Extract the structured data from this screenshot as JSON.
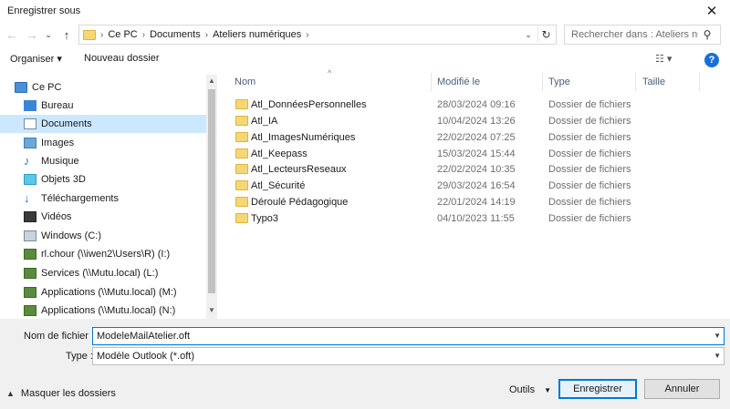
{
  "window": {
    "title": "Enregistrer sous",
    "close_glyph": "✕"
  },
  "nav": {
    "back": "←",
    "forward": "→",
    "recent": "⌄",
    "up": "↑"
  },
  "address": {
    "crumbs": [
      "Ce PC",
      "Documents",
      "Ateliers numériques"
    ],
    "separator": "›",
    "dropdown": "⌄",
    "refresh": "↻"
  },
  "search": {
    "placeholder": "Rechercher dans : Ateliers nu...",
    "icon": "⚲"
  },
  "toolbar": {
    "organiser": "Organiser ▾",
    "nouveau_dossier": "Nouveau dossier",
    "view": "☷ ▾",
    "help": "?"
  },
  "sidebar": {
    "items": [
      {
        "label": "Ce PC",
        "icon": "pc-icon"
      },
      {
        "label": "Bureau",
        "icon": "desktop-icon"
      },
      {
        "label": "Documents",
        "icon": "documents-icon"
      },
      {
        "label": "Images",
        "icon": "images-icon"
      },
      {
        "label": "Musique",
        "icon": "music-icon"
      },
      {
        "label": "Objets 3D",
        "icon": "cube-icon"
      },
      {
        "label": "Téléchargements",
        "icon": "download-icon"
      },
      {
        "label": "Vidéos",
        "icon": "video-icon"
      },
      {
        "label": "Windows (C:)",
        "icon": "drive-icon"
      },
      {
        "label": "rl.chour (\\\\iwen2\\Users\\R) (I:)",
        "icon": "network-drive-icon"
      },
      {
        "label": "Services (\\\\Mutu.local) (L:)",
        "icon": "network-drive-icon"
      },
      {
        "label": "Applications (\\\\Mutu.local) (M:)",
        "icon": "network-drive-icon"
      },
      {
        "label": "Applications (\\\\Mutu.local) (N:)",
        "icon": "network-drive-icon"
      }
    ],
    "selected": "Documents"
  },
  "columns": {
    "name": "Nom",
    "modified": "Modifié le",
    "type": "Type",
    "size": "Taille",
    "sort_glyph": "^"
  },
  "files": [
    {
      "name": "Atl_DonnéesPersonnelles",
      "modified": "28/03/2024 09:16",
      "type": "Dossier de fichiers"
    },
    {
      "name": "Atl_IA",
      "modified": "10/04/2024 13:26",
      "type": "Dossier de fichiers"
    },
    {
      "name": "Atl_ImagesNumériques",
      "modified": "22/02/2024 07:25",
      "type": "Dossier de fichiers"
    },
    {
      "name": "Atl_Keepass",
      "modified": "15/03/2024 15:44",
      "type": "Dossier de fichiers"
    },
    {
      "name": "Atl_LecteursReseaux",
      "modified": "22/02/2024 10:35",
      "type": "Dossier de fichiers"
    },
    {
      "name": "Atl_Sécurité",
      "modified": "29/03/2024 16:54",
      "type": "Dossier de fichiers"
    },
    {
      "name": "Déroulé Pédagogique",
      "modified": "22/01/2024 14:19",
      "type": "Dossier de fichiers"
    },
    {
      "name": "Typo3",
      "modified": "04/10/2023 11:55",
      "type": "Dossier de fichiers"
    }
  ],
  "form": {
    "filename_label": "Nom de fichier :",
    "filename_value": "ModeleMailAtelier.oft",
    "type_label": "Type :",
    "type_value": "Modèle Outlook (*.oft)"
  },
  "footer": {
    "hide_folders": "Masquer les dossiers",
    "tools": "Outils",
    "save": "Enregistrer",
    "cancel": "Annuler"
  },
  "colors": {
    "accent": "#0078d7",
    "selected": "#cce8ff",
    "folder": "#f7d774"
  }
}
